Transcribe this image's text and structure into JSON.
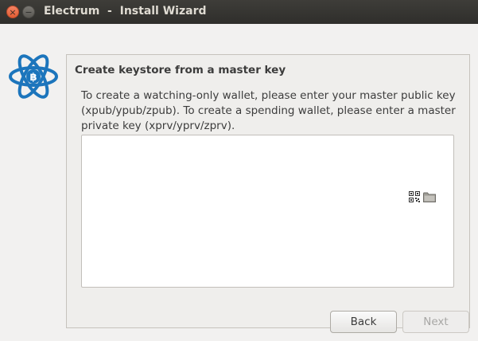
{
  "window": {
    "title": "Electrum  -  Install Wizard",
    "close_glyph": "×",
    "minimize_glyph": "−"
  },
  "wizard": {
    "heading": "Create keystore from a master key",
    "description": "To create a watching-only wallet, please enter your master public key (xpub/ypub/zpub). To create a spending wallet, please enter a master private key (xprv/yprv/zprv).",
    "key_input": {
      "value": "",
      "placeholder": ""
    },
    "icons": [
      "qrcode-icon",
      "folder-icon"
    ]
  },
  "buttons": {
    "back_label": "Back",
    "next_label": "Next",
    "next_enabled": false
  },
  "colors": {
    "logo_blue": "#1c75bc",
    "titlebar": "#3a3935",
    "close_button": "#e9653b"
  }
}
